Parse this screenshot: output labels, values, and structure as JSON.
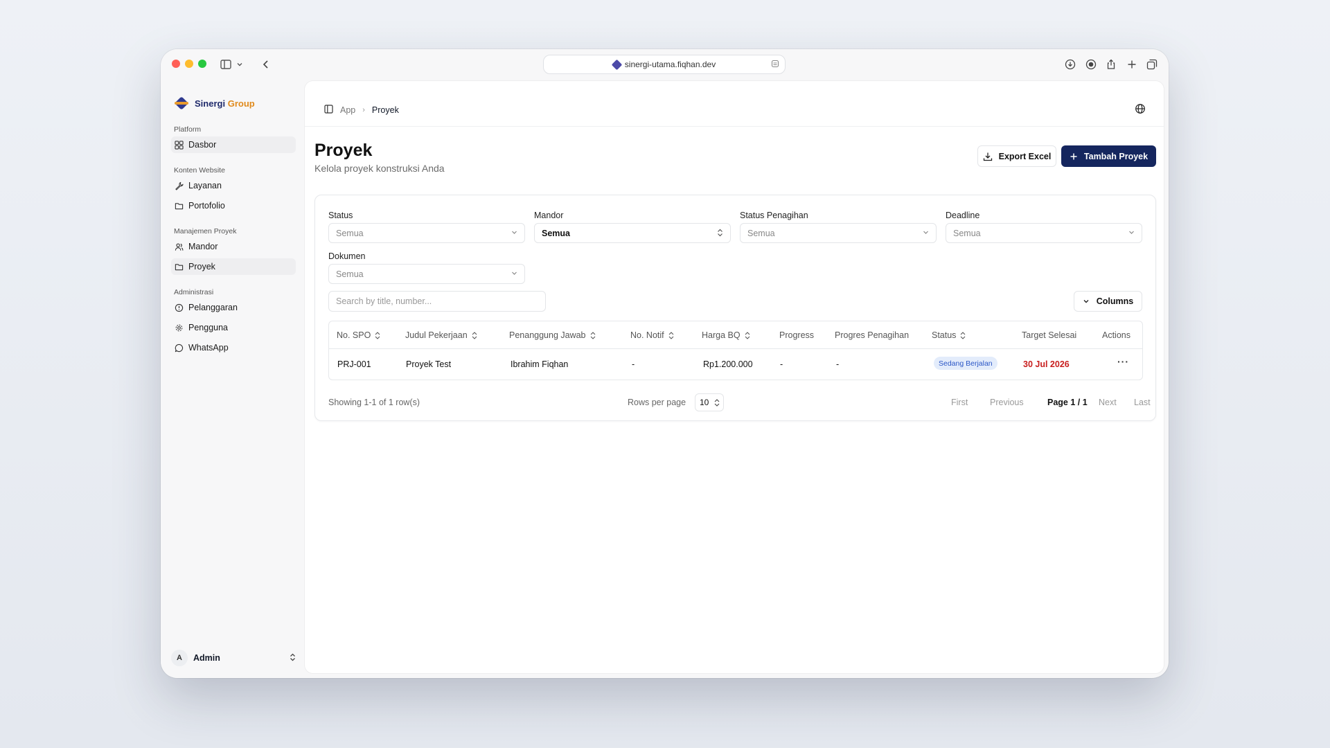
{
  "browser": {
    "url": "sinergi-utama.fiqhan.dev",
    "traffic_colors": [
      "#ff5f57",
      "#febc2e",
      "#28c840"
    ]
  },
  "brand": {
    "name_part1": "Sinergi",
    "name_part2": "Group",
    "color_primary": "#1f2a6b",
    "color_accent": "#e08a1c"
  },
  "sidebar": {
    "sections": [
      {
        "label": "Platform",
        "items": [
          {
            "label": "Dasbor",
            "icon": "grid-icon",
            "active": true
          }
        ]
      },
      {
        "label": "Konten Website",
        "items": [
          {
            "label": "Layanan",
            "icon": "wrench-icon"
          },
          {
            "label": "Portofolio",
            "icon": "folder-icon"
          }
        ]
      },
      {
        "label": "Manajemen Proyek",
        "items": [
          {
            "label": "Mandor",
            "icon": "users-icon"
          },
          {
            "label": "Proyek",
            "icon": "folder-icon",
            "active": true
          }
        ]
      },
      {
        "label": "Administrasi",
        "items": [
          {
            "label": "Pelanggaran",
            "icon": "alert-circle-icon"
          },
          {
            "label": "Pengguna",
            "icon": "gear-icon"
          },
          {
            "label": "WhatsApp",
            "icon": "chat-bubble-icon"
          }
        ]
      }
    ],
    "user": {
      "initial": "A",
      "name": "Admin"
    }
  },
  "breadcrumb": {
    "root": "App",
    "current": "Proyek"
  },
  "page": {
    "title": "Proyek",
    "subtitle": "Kelola proyek konstruksi Anda"
  },
  "actions": {
    "export_label": "Export Excel",
    "add_label": "Tambah Proyek",
    "primary_color": "#15265e"
  },
  "filters": {
    "status": {
      "label": "Status",
      "value": "Semua"
    },
    "mandor": {
      "label": "Mandor",
      "value": "Semua"
    },
    "status_penagihan": {
      "label": "Status Penagihan",
      "value": "Semua"
    },
    "deadline": {
      "label": "Deadline",
      "value": "Semua"
    },
    "dokumen": {
      "label": "Dokumen",
      "value": "Semua"
    }
  },
  "search": {
    "placeholder": "Search by title, number..."
  },
  "columns_button": "Columns",
  "table": {
    "headers": [
      "No. SPO",
      "Judul Pekerjaan",
      "Penanggung Jawab",
      "No. Notif",
      "Harga BQ",
      "Progress",
      "Progres Penagihan",
      "Status",
      "Target Selesai",
      "Actions"
    ],
    "rows": [
      {
        "no_spo": "PRJ-001",
        "judul": "Proyek Test",
        "penanggung_jawab": "Ibrahim Fiqhan",
        "no_notif": "-",
        "harga_bq": "Rp1.200.000",
        "progress": "-",
        "progres_penagihan": "-",
        "status": "Sedang Berjalan",
        "target_selesai": "30 Jul 2026",
        "actions": "···"
      }
    ]
  },
  "pagination": {
    "showing": "Showing 1-1 of 1 row(s)",
    "rows_per_page_label": "Rows per page",
    "rows_per_page_value": "10",
    "first": "First",
    "previous": "Previous",
    "page_indicator": "Page 1 / 1",
    "next": "Next",
    "last": "Last"
  }
}
